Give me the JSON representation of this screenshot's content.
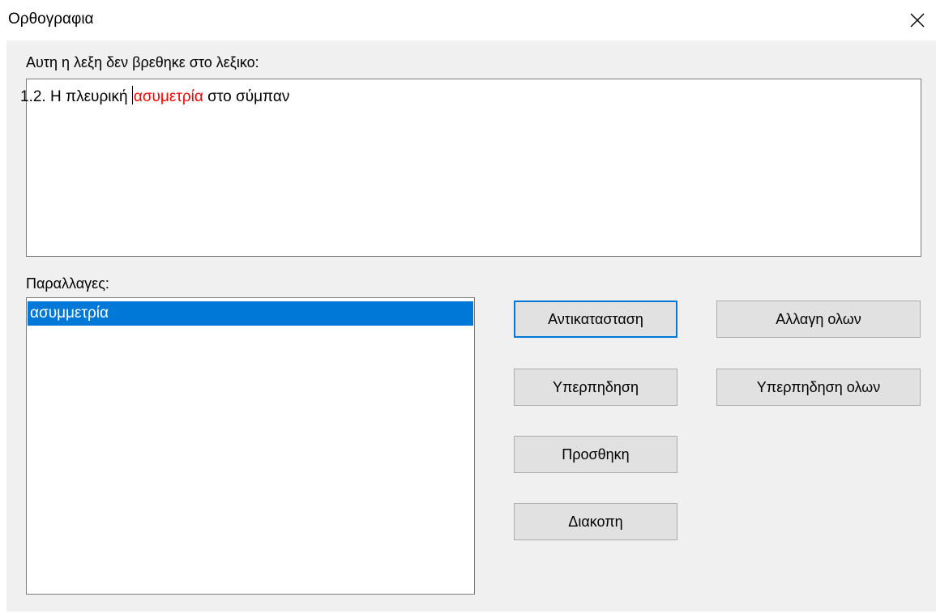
{
  "window": {
    "title": "Ορθογραφια",
    "close_icon": "close-icon"
  },
  "not_found": {
    "label": "Αυτη η λεξη δεν βρεθηκε στο λεξικο:",
    "sentence_before": "1.2. Η πλευρική ",
    "misspelled_word": "ασυμετρία",
    "sentence_after": " στο σύμπαν",
    "misspelled_color": "#ff0000"
  },
  "suggestions": {
    "label": "Παραλλαγες:",
    "items": [
      {
        "text": "ασυμμετρία",
        "selected": true
      }
    ],
    "selection_color": "#0078d7"
  },
  "buttons": {
    "replace": "Αντικατασταση",
    "replace_all": "Αλλαγη ολων",
    "ignore": "Υπερπηδηση",
    "ignore_all": "Υπερπηδηση ολων",
    "add": "Προσθηκη",
    "cancel": "Διακοπη"
  }
}
